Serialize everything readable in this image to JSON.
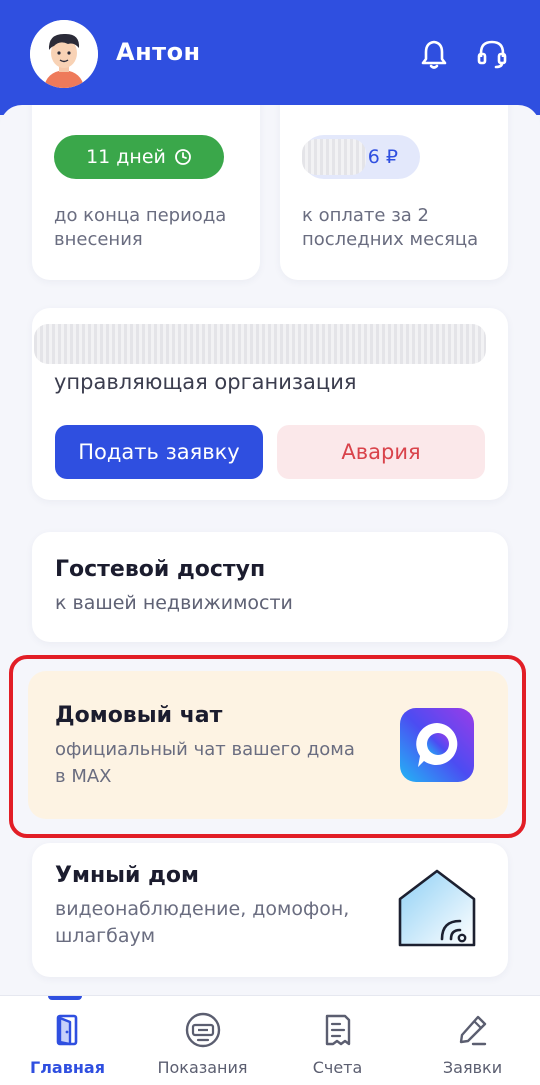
{
  "header": {
    "user_name": "Антон",
    "icons": [
      "avatar",
      "bell-icon",
      "headset-icon"
    ],
    "colors": {
      "background": "#2f4fe0",
      "text": "#ffffff"
    }
  },
  "payment_period": {
    "days_badge": "11 дней",
    "badge_icon": "clock-icon",
    "caption": "до конца периода внесения"
  },
  "payment_due": {
    "amount": "6 ₽",
    "caption": "к оплате за 2 последних месяца"
  },
  "management": {
    "subtitle": "управляющая организация",
    "submit_button": "Подать заявку",
    "emergency_button": "Авария"
  },
  "guest_access": {
    "title": "Гостевой доступ",
    "subtitle": "к вашей недвижимости"
  },
  "house_chat": {
    "title": "Домовый чат",
    "subtitle": "официальный чат вашего дома в MAX",
    "icon": "max-app-icon",
    "colors": {
      "card": "#fdf3e3",
      "highlight": "#e21e26"
    }
  },
  "smart_home": {
    "title": "Умный дом",
    "subtitle": "видеонаблюдение, домофон, шлагбаум",
    "icon": "smart-house-icon"
  },
  "bottom_nav": {
    "items": [
      {
        "label": "Главная",
        "icon": "door-icon",
        "active": true
      },
      {
        "label": "Показания",
        "icon": "meter-icon",
        "active": false
      },
      {
        "label": "Счета",
        "icon": "receipt-icon",
        "active": false
      },
      {
        "label": "Заявки",
        "icon": "pencil-icon",
        "active": false
      }
    ]
  },
  "colors": {
    "accent": "#2f4fe0",
    "success": "#3aa74a",
    "danger": "#d9434b"
  }
}
